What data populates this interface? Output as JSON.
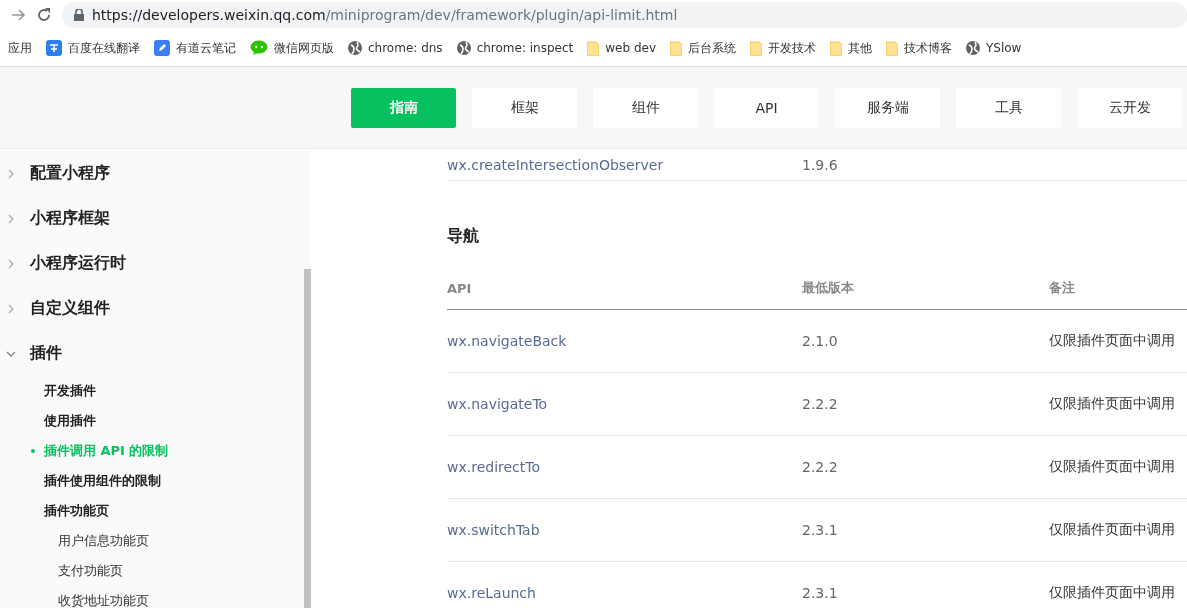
{
  "browser": {
    "url_host": "https://developers.weixin.qq.com",
    "url_path": "/miniprogram/dev/framework/plugin/api-limit.html",
    "bookmarks": [
      {
        "label": "应用",
        "kind": "text"
      },
      {
        "label": "百度在线翻译",
        "kind": "translate"
      },
      {
        "label": "有道云笔记",
        "kind": "note"
      },
      {
        "label": "微信网页版",
        "kind": "chat"
      },
      {
        "label": "chrome: dns",
        "kind": "globe"
      },
      {
        "label": "chrome: inspect",
        "kind": "globe"
      },
      {
        "label": "web dev",
        "kind": "folder"
      },
      {
        "label": "后台系统",
        "kind": "folder"
      },
      {
        "label": "开发技术",
        "kind": "folder"
      },
      {
        "label": "其他",
        "kind": "folder"
      },
      {
        "label": "技术博客",
        "kind": "folder"
      },
      {
        "label": "YSlow",
        "kind": "globe"
      }
    ]
  },
  "nav": [
    {
      "label": "指南",
      "selected": true
    },
    {
      "label": "框架",
      "selected": false
    },
    {
      "label": "组件",
      "selected": false
    },
    {
      "label": "API",
      "selected": false
    },
    {
      "label": "服务端",
      "selected": false
    },
    {
      "label": "工具",
      "selected": false
    },
    {
      "label": "云开发",
      "selected": false
    }
  ],
  "sidebar": {
    "items": [
      {
        "label": "配置小程序",
        "expanded": false
      },
      {
        "label": "小程序框架",
        "expanded": false
      },
      {
        "label": "小程序运行时",
        "expanded": false
      },
      {
        "label": "自定义组件",
        "expanded": false
      },
      {
        "label": "插件",
        "expanded": true,
        "children": [
          {
            "label": "开发插件",
            "selected": false
          },
          {
            "label": "使用插件",
            "selected": false
          },
          {
            "label": "插件调用 API 的限制",
            "selected": true
          },
          {
            "label": "插件使用组件的限制",
            "selected": false
          },
          {
            "label": "插件功能页",
            "selected": false,
            "children": [
              {
                "label": "用户信息功能页",
                "selected": false
              },
              {
                "label": "支付功能页",
                "selected": false
              },
              {
                "label": "收货地址功能页",
                "selected": false
              }
            ]
          }
        ]
      }
    ]
  },
  "content": {
    "prev_row": {
      "api": "wx.createIntersectionObserver",
      "version": "1.9.6"
    },
    "section_title": "导航",
    "table": {
      "columns": [
        "API",
        "最低版本",
        "备注"
      ],
      "rows": [
        {
          "api": "wx.navigateBack",
          "version": "2.1.0",
          "note": "仅限插件页面中调用"
        },
        {
          "api": "wx.navigateTo",
          "version": "2.2.2",
          "note": "仅限插件页面中调用"
        },
        {
          "api": "wx.redirectTo",
          "version": "2.2.2",
          "note": "仅限插件页面中调用"
        },
        {
          "api": "wx.switchTab",
          "version": "2.3.1",
          "note": "仅限插件页面中调用"
        },
        {
          "api": "wx.reLaunch",
          "version": "2.3.1",
          "note": "仅限插件页面中调用"
        }
      ]
    }
  }
}
